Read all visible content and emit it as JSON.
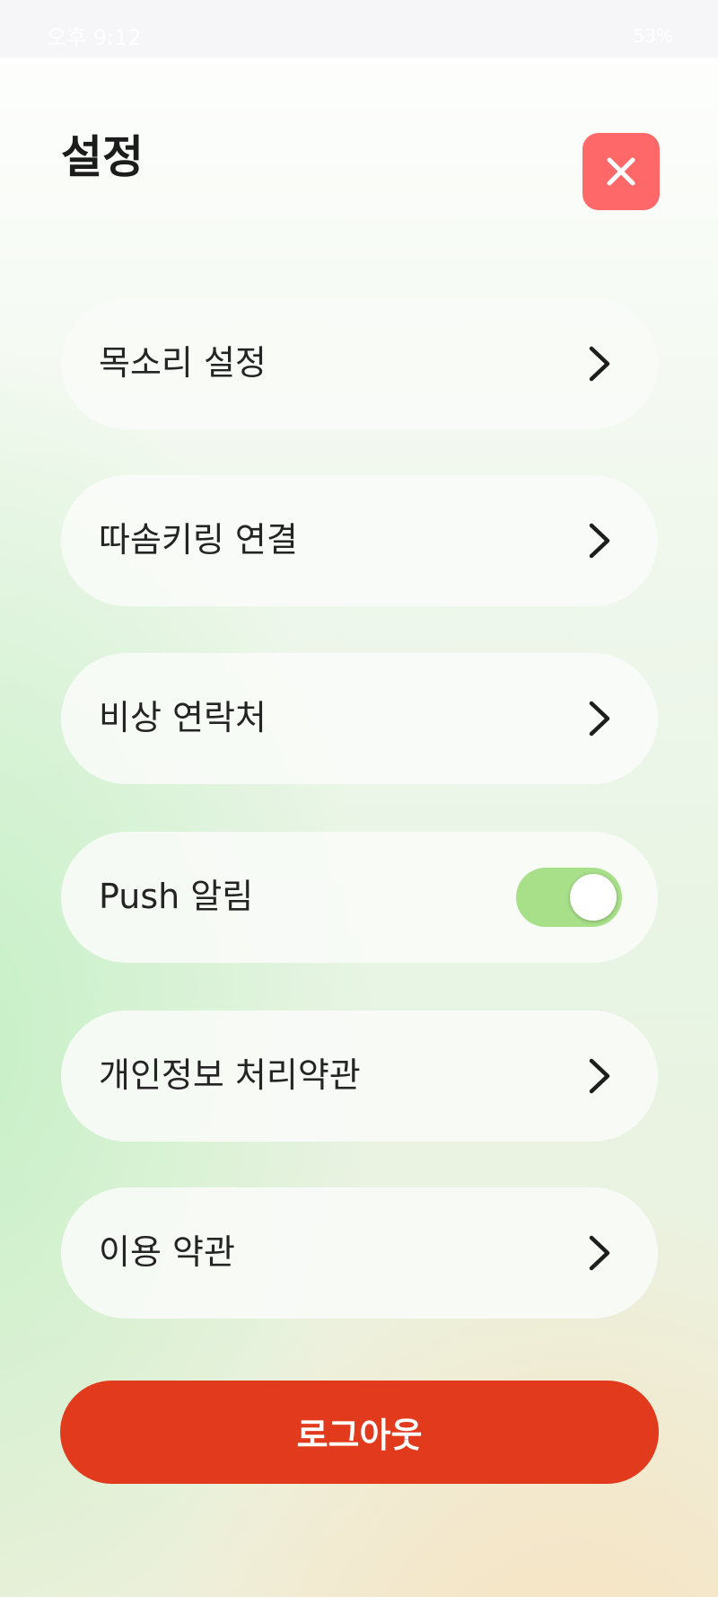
{
  "status_bar": {
    "time": "오후 9:12",
    "battery": "53%"
  },
  "header": {
    "title": "설정",
    "close_icon": "close-icon"
  },
  "menu": [
    {
      "label": "목소리 설정",
      "icon": "chevron-right-icon"
    },
    {
      "label": "따솜키링 연결",
      "icon": "chevron-right-icon"
    },
    {
      "label": "비상 연락처",
      "icon": "chevron-right-icon"
    },
    {
      "label": "Push 알림",
      "toggle_on": true
    },
    {
      "label": "개인정보 처리약관",
      "icon": "chevron-right-icon"
    },
    {
      "label": "이용 약관",
      "icon": "chevron-right-icon"
    }
  ],
  "logout": {
    "label": "로그아웃"
  },
  "colors": {
    "accent_close": "#ff6868",
    "logout": "#e13a1c",
    "toggle_on": "#a8e08a",
    "text": "#242424"
  }
}
